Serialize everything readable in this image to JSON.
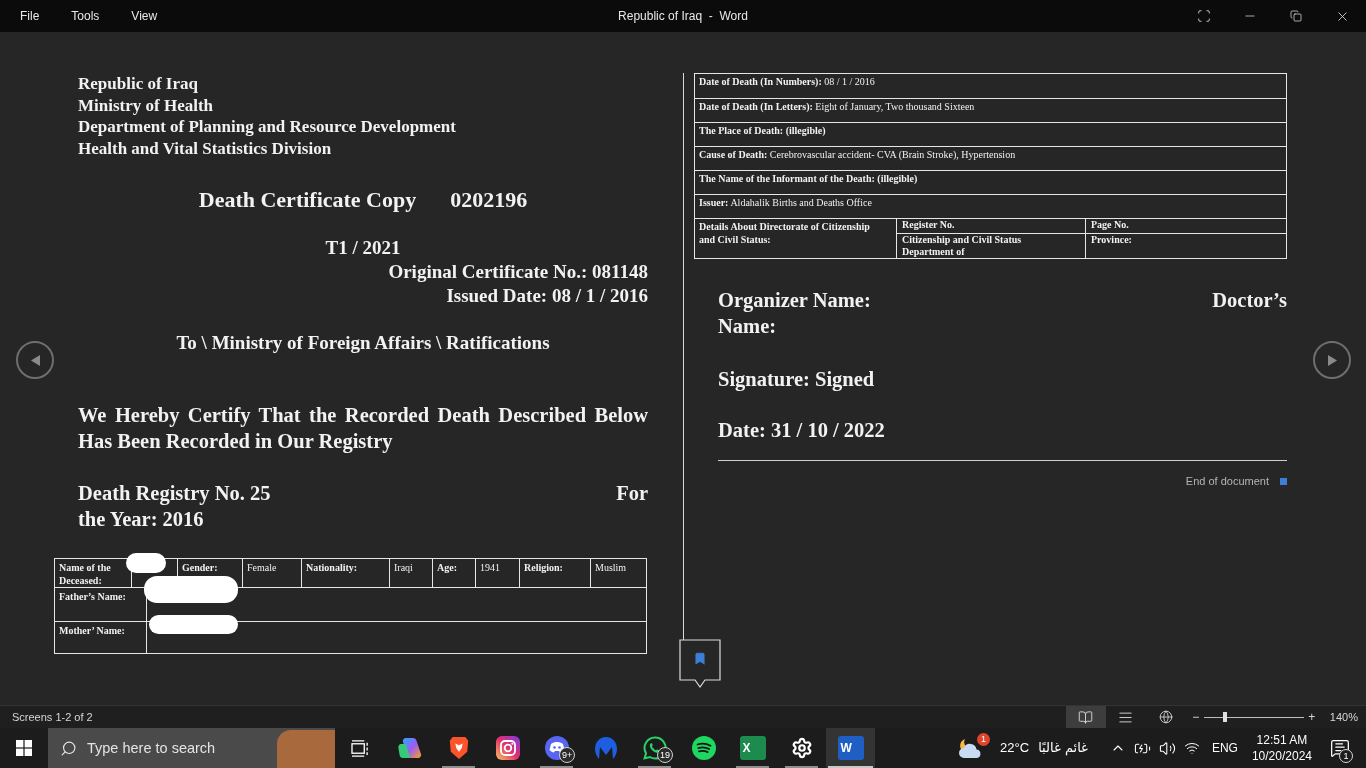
{
  "window": {
    "title": "Republic of Iraq  -  Word",
    "menu": [
      "File",
      "Tools",
      "View"
    ]
  },
  "page_1": {
    "header_lines": [
      "Republic of Iraq",
      "Ministry of Health",
      "Department of Planning and Resource Development",
      "Health and Vital Statistics Division"
    ],
    "title": "Death Certificate Copy",
    "certificate_number": "0202196",
    "reference": "T1 / 2021",
    "original_certificate": "Original Certificate No.: 081148",
    "issued_date": "Issued Date: 08 / 1 / 2016",
    "addressee": "To \\ Ministry of Foreign Affairs \\ Ratifications",
    "statement": "We Hereby Certify That the Recorded Death Described Below Has Been Recorded in Our Registry",
    "registry": {
      "number": "Death Registry No. 25",
      "year_start": "For",
      "year_end": "the Year: 2016"
    },
    "deceased_table": {
      "rows": [
        [
          {
            "kind": "label",
            "text": "Name of the Deceased:",
            "redacted": false
          },
          {
            "kind": "value",
            "redacted": true
          },
          {
            "kind": "label",
            "text": "Gender:",
            "redacted": false
          },
          {
            "kind": "value",
            "text": "Female",
            "redacted": false
          },
          {
            "kind": "label",
            "text": "Nationality:",
            "redacted": false
          },
          {
            "kind": "value",
            "text": "Iraqi",
            "redacted": false
          },
          {
            "kind": "label",
            "text": "Age:",
            "redacted": false
          },
          {
            "kind": "value",
            "text": "1941",
            "redacted": false
          },
          {
            "kind": "label",
            "text": "Religion:",
            "redacted": false
          },
          {
            "kind": "value",
            "text": "Muslim",
            "redacted": false
          }
        ],
        [
          {
            "kind": "label",
            "text": "Father’s Name:",
            "redacted": false
          },
          {
            "kind": "value",
            "redacted": true
          }
        ],
        [
          {
            "kind": "label",
            "text": "Mother’ Name:",
            "redacted": false
          },
          {
            "kind": "value",
            "redacted": true
          }
        ]
      ]
    }
  },
  "page_2": {
    "details_table": {
      "rows": [
        {
          "text": "**Date of Death (In Numbers):** 08 / 1 / 2016",
          "bold": false
        },
        {
          "text": "**Date of Death (In Letters):** Eight of January, Two thousand Sixteen",
          "bold": false
        },
        {
          "text": "The Place of Death: (illegible)",
          "bold": true
        },
        {
          "text": "**Cause of Death:** Cerebrovascular accident- CVA (Brain Stroke), Hypertension",
          "bold": false
        },
        {
          "text": "The Name of the Informant of the Death: (illegible)",
          "bold": true
        },
        {
          "text": "**Issuer:** Aldahalik Births and Deaths Office",
          "bold": false
        }
      ],
      "citizenship": {
        "heading": "Details About Directorate of Citizenship and Civil Status:",
        "cells": [
          [
            "Register No.",
            "Page No."
          ],
          [
            "Citizenship and Civil Status Department of",
            "Province:"
          ]
        ]
      }
    },
    "organizer_label": "Organizer Name:",
    "doctor_label_start": "Doctor’s",
    "doctor_label_end": "Name:",
    "signature": "Signature: Signed",
    "date": "Date: 31 / 10 / 2022",
    "end_marker": "End of document"
  },
  "status_bar": {
    "pages": "Screens 1-2 of 2",
    "views": [
      {
        "kind": "read",
        "selected": true
      },
      {
        "kind": "print",
        "selected": false
      },
      {
        "kind": "web",
        "selected": false
      }
    ],
    "zoom": {
      "minus": "−",
      "plus": "+",
      "level": 0.21,
      "reading": "140%"
    }
  },
  "taskbar": {
    "search": {
      "placeholder": "Type here to search"
    },
    "apps": [
      {
        "kind": "task-view",
        "running": false,
        "selected": false
      },
      {
        "kind": "swirl",
        "running": false,
        "selected": false
      },
      {
        "kind": "shield",
        "running": true,
        "selected": false
      },
      {
        "kind": "camera",
        "running": false,
        "selected": false
      },
      {
        "kind": "chat-bubble",
        "badge": "9+",
        "running": true,
        "selected": false
      },
      {
        "kind": "m-logo",
        "running": false,
        "selected": false
      },
      {
        "kind": "phone-chat",
        "badge": "19",
        "running": true,
        "selected": false
      },
      {
        "kind": "sound-waves",
        "running": false,
        "selected": false
      },
      {
        "kind": "spreadsheet",
        "glyph": "X",
        "running": true,
        "selected": false
      },
      {
        "kind": "gear",
        "running": true,
        "selected": false
      },
      {
        "kind": "document",
        "glyph": "W",
        "running": true,
        "selected": true
      }
    ],
    "weather": {
      "badge": "1",
      "temperature": "22°C",
      "condition": "غائم غالبًا"
    },
    "tray": {
      "language": "ENG",
      "time": "12:51 AM",
      "date": "10/20/2024",
      "notification_badge": "1"
    }
  }
}
